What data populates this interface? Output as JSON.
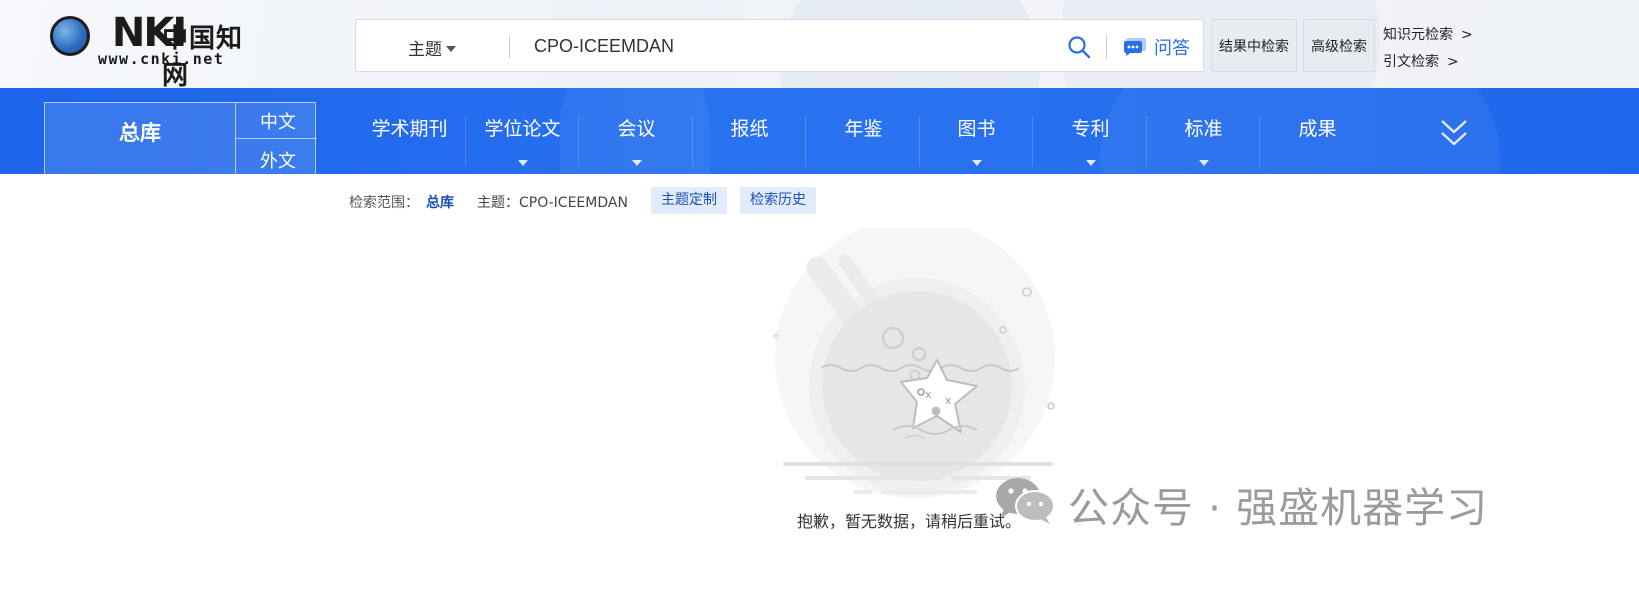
{
  "header": {
    "logo": {
      "letters": "CNKI",
      "chinese": "中国知网",
      "url": "www.cnki.net",
      "icon": "globe-icon"
    },
    "search": {
      "field": "主题",
      "query": "CPO-ICEEMDAN",
      "search_icon": "search-icon",
      "qa_icon": "chat-bubble-icon",
      "qa_label": "问答"
    },
    "buttons": {
      "result_search": "结果中检索",
      "advanced_search": "高级检索"
    },
    "links": {
      "knowledge_search": "知识元检索",
      "citation_search": "引文检索",
      "arrow": ">"
    }
  },
  "nav": {
    "total": "总库",
    "lang_zh": "中文",
    "lang_en": "外文",
    "items": [
      {
        "label": "学术期刊",
        "dropdown": false
      },
      {
        "label": "学位论文",
        "dropdown": true
      },
      {
        "label": "会议",
        "dropdown": true
      },
      {
        "label": "报纸",
        "dropdown": false
      },
      {
        "label": "年鉴",
        "dropdown": false
      },
      {
        "label": "图书",
        "dropdown": true
      },
      {
        "label": "专利",
        "dropdown": true
      },
      {
        "label": "标准",
        "dropdown": true
      },
      {
        "label": "成果",
        "dropdown": false
      }
    ],
    "more_icon": "double-chevron-down-icon"
  },
  "scope": {
    "label": "检索范围：",
    "library": "总库",
    "topic": "主题：CPO-ICEEMDAN",
    "topic_custom": "主题定制",
    "history": "检索历史"
  },
  "empty": {
    "illustration": "starfish-empty-illustration",
    "message": "抱歉，暂无数据，请稍后重试。"
  },
  "watermark": {
    "icon": "wechat-icon",
    "text": "公众号 · 强盛机器学习"
  },
  "colors": {
    "nav_blue": "#1d64ea",
    "link_blue": "#2a6ee8",
    "tag_bg": "#e1ebfb",
    "tag_text": "#1d4fb4"
  }
}
